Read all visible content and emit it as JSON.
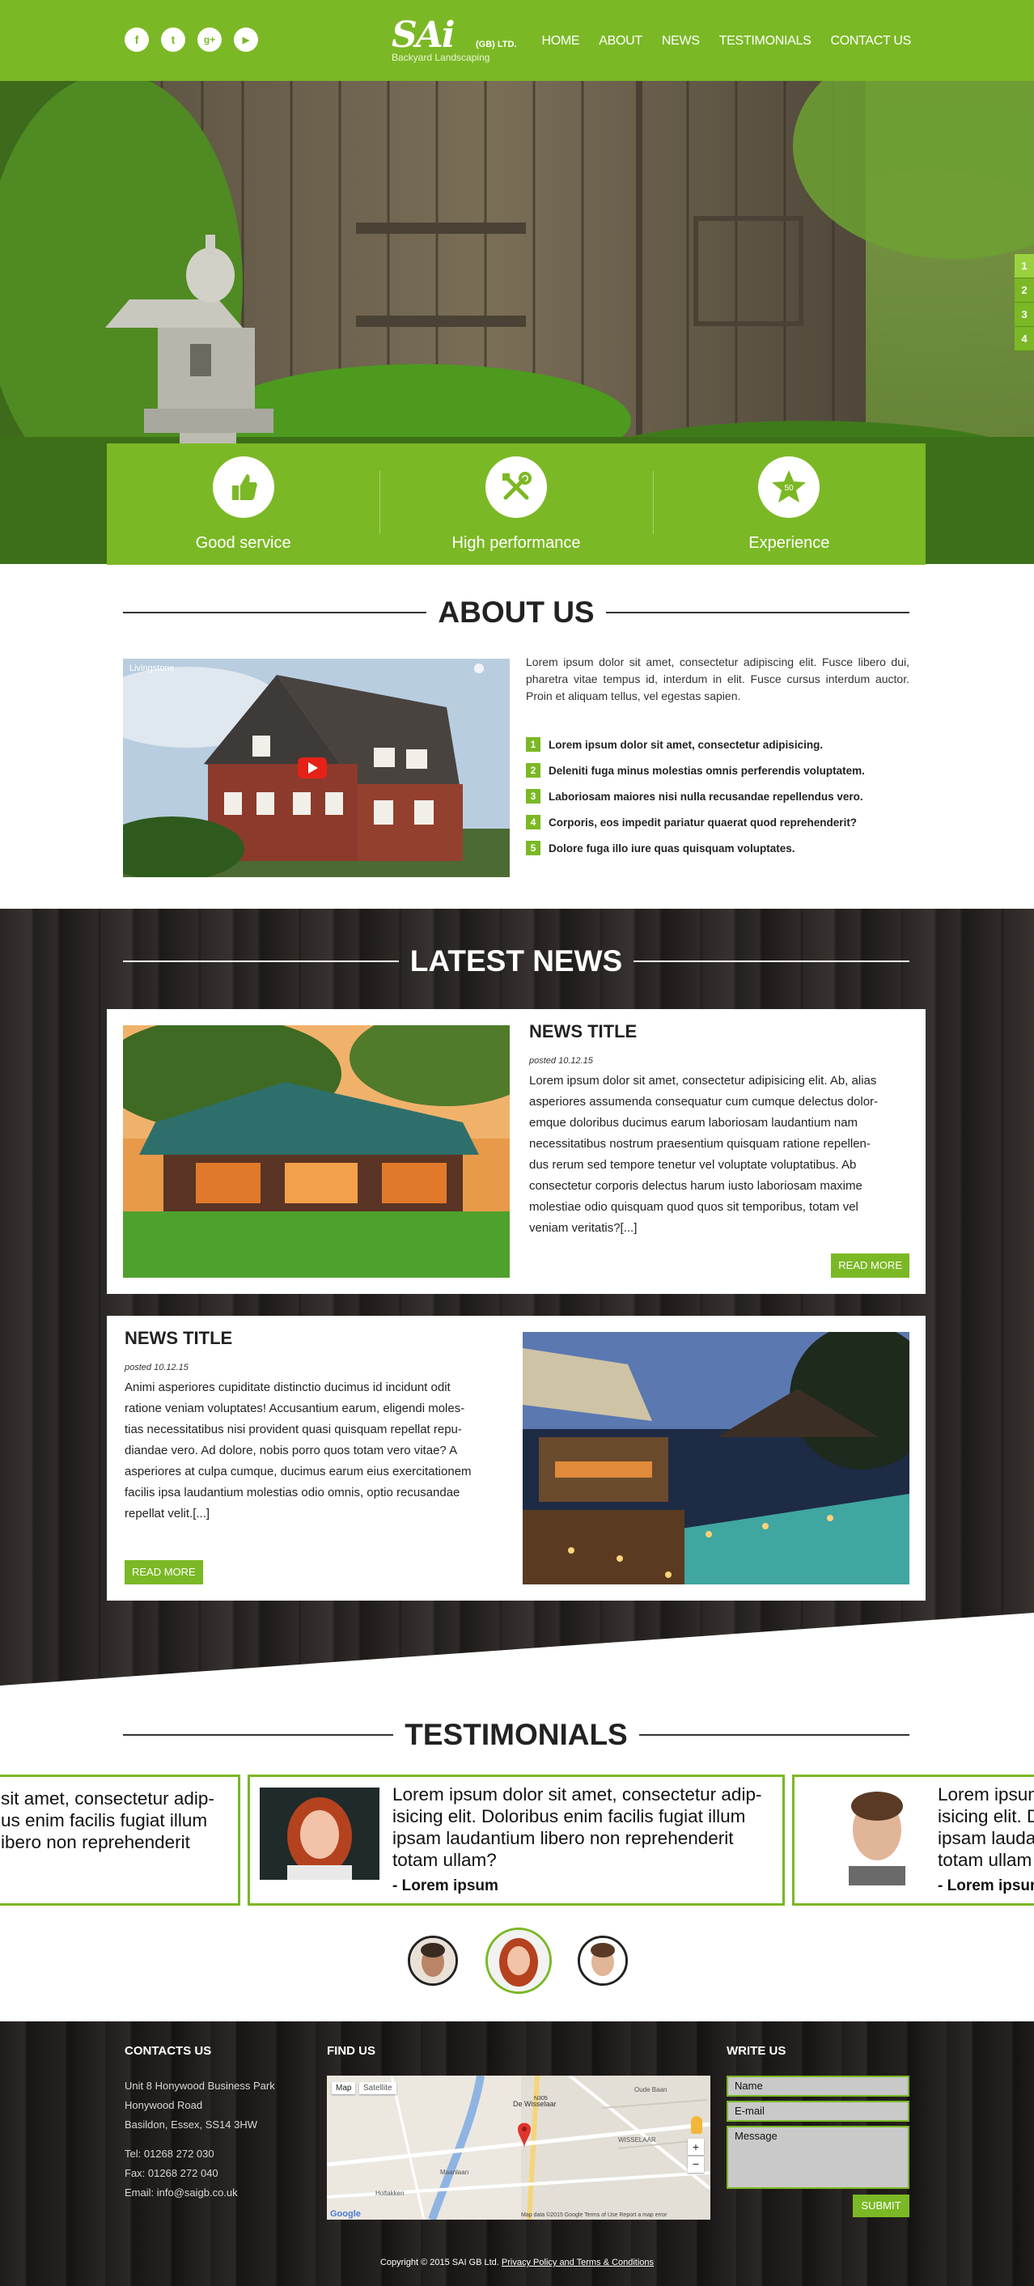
{
  "header": {
    "social": [
      {
        "glyph": "f",
        "icon": "facebook-icon"
      },
      {
        "glyph": "t",
        "icon": "twitter-icon"
      },
      {
        "glyph": "g+",
        "icon": "google-plus-icon"
      },
      {
        "glyph": "▶",
        "icon": "youtube-icon"
      }
    ],
    "logo": {
      "main": "SAi",
      "ltd": "(GB) LTD.",
      "tagline": "Backyard Landscaping"
    },
    "nav": [
      "HOME",
      "ABOUT",
      "NEWS",
      "TESTIMONIALS",
      "CONTACT US"
    ]
  },
  "hero": {
    "slides": [
      "1",
      "2",
      "3",
      "4"
    ],
    "features": [
      {
        "label": "Good service",
        "icon": "thumbs-up-icon"
      },
      {
        "label": "High performance",
        "icon": "tools-icon"
      },
      {
        "label": "Experience",
        "icon": "star-badge-icon",
        "badge": "50"
      }
    ]
  },
  "about": {
    "title": "ABOUT US",
    "video_label": "Livingstone",
    "text": "Lorem ipsum dolor sit amet, consectetur adipiscing elit. Fusce libero dui, pharetra vitae tempus id, interdum in elit. Fusce cursus interdum auctor. Proin et aliquam tellus, vel egestas sapien.",
    "items": [
      {
        "n": "1",
        "text": "Lorem ipsum dolor sit amet, consectetur adipisicing."
      },
      {
        "n": "2",
        "text": "Deleniti fuga minus molestias omnis perferendis voluptatem."
      },
      {
        "n": "3",
        "text": "Laboriosam maiores nisi nulla recusandae repellendus vero."
      },
      {
        "n": "4",
        "text": "Corporis, eos impedit pariatur quaerat quod reprehenderit?"
      },
      {
        "n": "5",
        "text": "Dolore fuga illo iure quas quisquam voluptates."
      }
    ]
  },
  "news": {
    "title": "LATEST NEWS",
    "items": [
      {
        "title": "NEWS TITLE",
        "date": "posted 10.12.15",
        "lines": [
          "Lorem ipsum dolor sit amet, consectetur adipisicing elit. Ab, alias",
          "asperiores assumenda consequatur cum cumque delectus dolor-",
          "emque doloribus ducimus earum laboriosam laudantium nam",
          "necessitatibus nostrum praesentium quisquam ratione repellen-",
          "dus rerum sed tempore tenetur vel voluptate voluptatibus. Ab",
          "consectetur corporis delectus harum iusto laboriosam maxime",
          "molestiae odio quisquam quod quos sit temporibus, totam vel",
          "veniam veritatis?[...]"
        ],
        "button": "READ MORE"
      },
      {
        "title": "NEWS TITLE",
        "date": "posted 10.12.15",
        "lines": [
          "Animi asperiores cupiditate distinctio ducimus id incidunt odit",
          "ratione veniam voluptates! Accusantium earum, eligendi moles-",
          "tias necessitatibus nisi provident quasi quisquam repellat repu-",
          "diandae vero. Ad dolore, nobis porro quos totam vero vitae? A",
          "asperiores at culpa cumque, ducimus earum eius exercitationem",
          "facilis ipsa laudantium molestias odio omnis, optio recusandae",
          "repellat velit.[...]"
        ],
        "button": "READ MORE"
      }
    ]
  },
  "testimonials": {
    "title": "TESTIMONIALS",
    "left_lines": [
      "sit amet, consectetur adip-",
      "us enim facilis fugiat illum",
      "ibero non reprehenderit"
    ],
    "center_lines": [
      "Lorem ipsum dolor sit amet, consectetur adip-",
      "isicing elit. Doloribus enim facilis fugiat illum",
      "ipsam laudantium libero non reprehenderit",
      "totam ullam?"
    ],
    "center_author": "- Lorem ipsum",
    "right_lines": [
      "Lorem ipsum",
      "isicing elit. D",
      "ipsam lauda",
      "totam ullam"
    ],
    "right_author": "- Lorem ipsum"
  },
  "footer": {
    "contacts": {
      "title": "CONTACTS US",
      "lines": [
        "Unit 8 Honywood Business Park",
        "Honywood Road",
        "Basildon, Essex, SS14 3HW"
      ],
      "tel": "Tel: 01268 272 030",
      "fax": "Fax: 01268 272 040",
      "email": "Email: info@saigb.co.uk"
    },
    "find": {
      "title": "FIND US",
      "tabs": [
        "Map",
        "Satellite"
      ],
      "labels": [
        "De Wisselaar",
        "N305",
        "WISSELAAR",
        "Maanlaan",
        "Holtakken",
        "Oude Baan"
      ],
      "footer": "Map data ©2015 Google   Terms of Use   Report a map error",
      "google": "Google"
    },
    "write": {
      "title": "WRITE US",
      "name": "Name",
      "email": "E-mail",
      "message": "Message",
      "submit": "SUBMIT"
    },
    "copyright": "Copyright © 2015 SAI GB Ltd.",
    "policy": "Privacy Policy and Terms & Conditions"
  },
  "colors": {
    "accent": "#7bb825",
    "dark": "#2a2624"
  }
}
